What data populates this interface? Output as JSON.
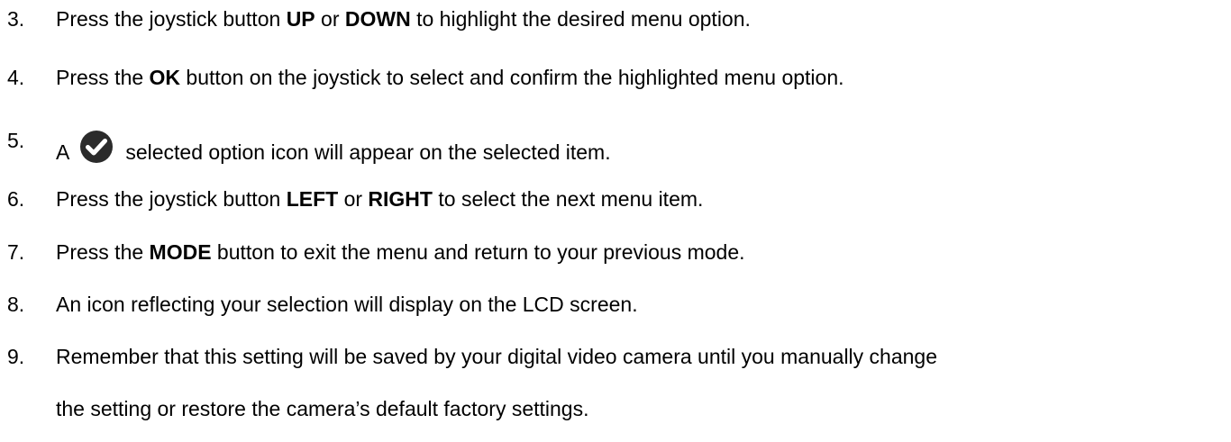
{
  "steps": [
    {
      "number": "3.",
      "parts": [
        "Press the joystick button ",
        "UP",
        " or ",
        "DOWN",
        " to highlight the desired menu option."
      ]
    },
    {
      "number": "4.",
      "parts": [
        "Press the ",
        "OK",
        " button on the joystick to select and confirm the highlighted menu option."
      ]
    },
    {
      "number": "5.",
      "parts": [
        "A",
        "selected option icon will appear on the selected item."
      ],
      "icon": "checkmark-circle-icon"
    },
    {
      "number": "6.",
      "parts": [
        "Press the joystick button ",
        "LEFT",
        " or ",
        "RIGHT",
        " to select the next menu item."
      ]
    },
    {
      "number": "7.",
      "parts": [
        "Press the ",
        "MODE",
        " button to exit the menu and return to your previous mode."
      ]
    },
    {
      "number": "8.",
      "parts": [
        "An icon reflecting your selection will display on the LCD screen."
      ]
    },
    {
      "number": "9.",
      "parts": [
        "Remember that this setting will be saved by your digital video camera until you manually change",
        "the setting or restore the camera’s default factory settings."
      ]
    }
  ],
  "colors": {
    "text": "#000000",
    "icon": "#2b2b2b"
  }
}
